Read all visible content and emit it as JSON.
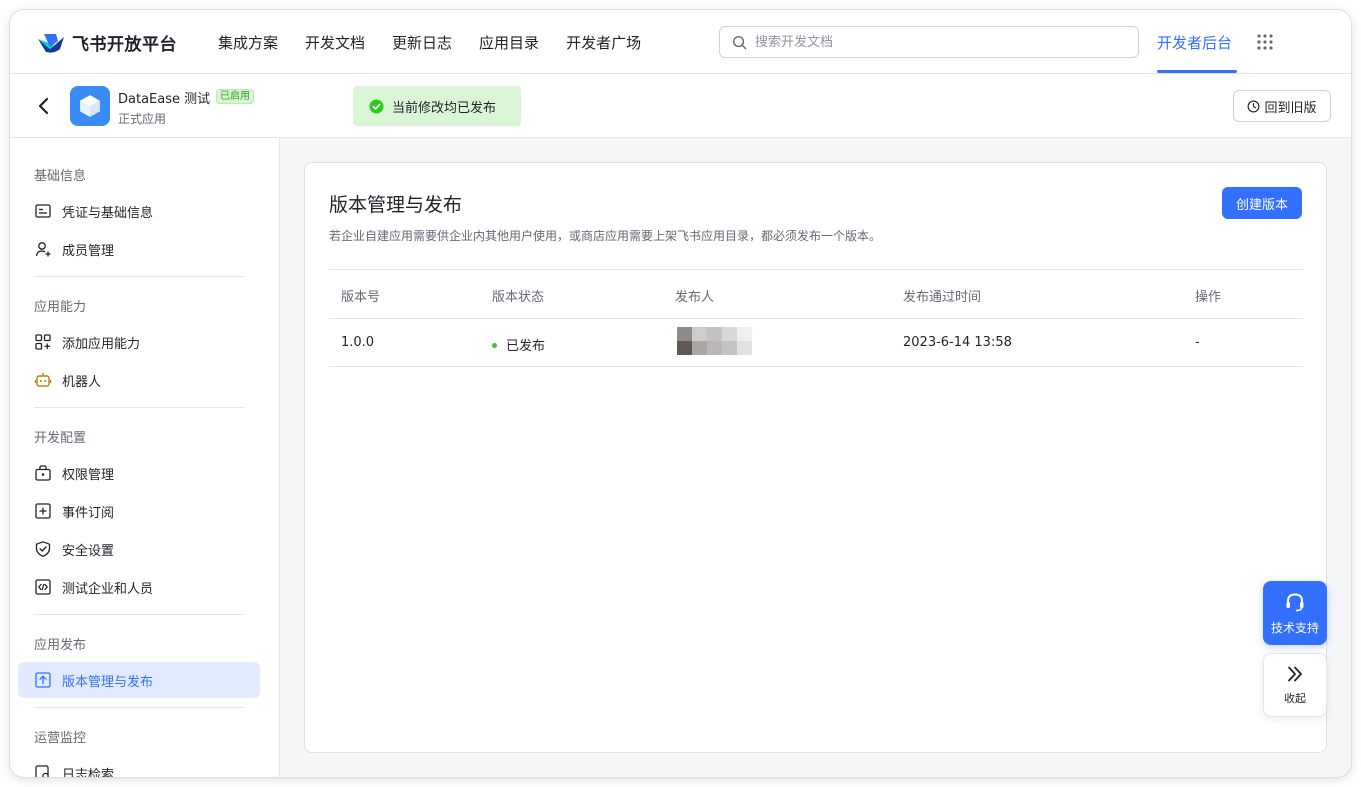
{
  "topnav": {
    "brand": "飞书开放平台",
    "links": [
      "集成方案",
      "开发文档",
      "更新日志",
      "应用目录",
      "开发者广场"
    ],
    "search_placeholder": "搜索开发文档",
    "dev_console": "开发者后台",
    "accent_color": "#3370ff"
  },
  "app": {
    "name": "DataEase 测试",
    "status_badge": "已启用",
    "type": "正式应用",
    "publish_notice": "当前修改均已发布",
    "revert_label": "回到旧版"
  },
  "sidebar": {
    "sections": [
      {
        "title": "基础信息",
        "items": [
          {
            "label": "凭证与基础信息",
            "icon": "credential-icon"
          },
          {
            "label": "成员管理",
            "icon": "add-member-icon"
          }
        ]
      },
      {
        "title": "应用能力",
        "items": [
          {
            "label": "添加应用能力",
            "icon": "add-capability-icon"
          },
          {
            "label": "机器人",
            "icon": "robot-icon"
          }
        ]
      },
      {
        "title": "开发配置",
        "items": [
          {
            "label": "权限管理",
            "icon": "permission-icon"
          },
          {
            "label": "事件订阅",
            "icon": "event-subscription-icon"
          },
          {
            "label": "安全设置",
            "icon": "shield-icon"
          },
          {
            "label": "测试企业和人员",
            "icon": "code-icon"
          }
        ]
      },
      {
        "title": "应用发布",
        "items": [
          {
            "label": "版本管理与发布",
            "icon": "upload-icon",
            "active": true
          }
        ]
      },
      {
        "title": "运营监控",
        "items": [
          {
            "label": "日志检索",
            "icon": "log-search-icon"
          }
        ]
      }
    ]
  },
  "main": {
    "title": "版本管理与发布",
    "description": "若企业自建应用需要供企业内其他用户使用，或商店应用需要上架飞书应用目录，都必须发布一个版本。",
    "create_button": "创建版本",
    "table": {
      "columns": [
        "版本号",
        "版本状态",
        "发布人",
        "发布通过时间",
        "操作"
      ],
      "rows": [
        {
          "version": "1.0.0",
          "status": "已发布",
          "publisher": "",
          "time": "2023-6-14 13:58",
          "action": "-"
        }
      ]
    }
  },
  "floating": {
    "support_label": "技术支持",
    "collapse_label": "收起"
  }
}
